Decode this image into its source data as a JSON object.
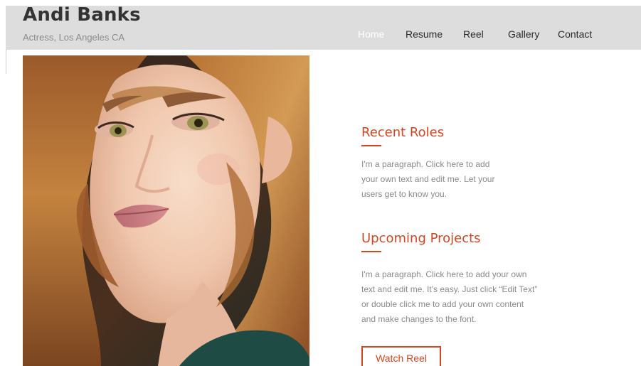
{
  "header": {
    "title": "Andi Banks",
    "subtitle": "Actress, Los Angeles CA"
  },
  "nav": {
    "items": [
      {
        "label": "Home",
        "active": true
      },
      {
        "label": "Resume",
        "active": false
      },
      {
        "label": "Reel",
        "active": false
      },
      {
        "label": "Gallery",
        "active": false
      },
      {
        "label": "Contact",
        "active": false
      }
    ]
  },
  "hero": {
    "image_subject": "portrait of woman with long auburn hair"
  },
  "sections": {
    "recent_roles": {
      "heading": "Recent Roles",
      "lines": [
        "I'm a paragraph. Click here to add",
        "your own text and edit me. Let your",
        "users get to know you."
      ]
    },
    "upcoming_projects": {
      "heading": "Upcoming Projects",
      "lines": [
        "I'm a paragraph. Click here to add your own",
        "text and edit me. It's easy. Just click “Edit Text”",
        "or double click me to add your own content",
        "and make changes to the font."
      ]
    }
  },
  "cta": {
    "label": "Watch Reel"
  },
  "colors": {
    "accent": "#d4461f",
    "header_bg": "#dddddd",
    "title": "#333333",
    "muted_text": "#8a8a8a",
    "active_nav": "#ffffff"
  }
}
